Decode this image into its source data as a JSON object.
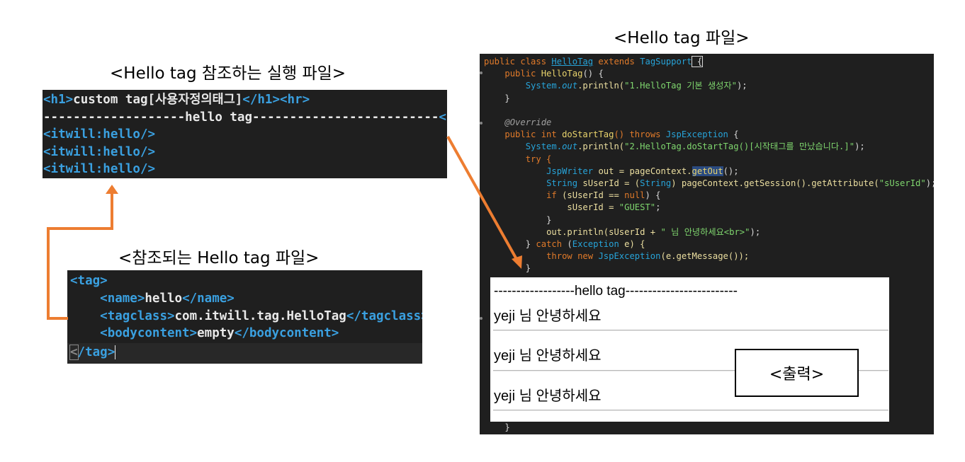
{
  "captions": {
    "exec_file": "<Hello tag 참조하는 실행 파일>",
    "referenced_file": "<참조되는 Hello tag 파일>",
    "java_file": "<Hello tag 파일>",
    "output_label": "<출력>"
  },
  "jsp": {
    "line1_open": "<h1>",
    "line1_text": "custom tag[사용자정의태그]",
    "line1_close": "</h1><hr>",
    "line2_text": "-------------------hello tag-------------------------",
    "line2_tag": "<br>",
    "line3": "<itwill:hello/>",
    "line4": "<itwill:hello/>",
    "line5": "<itwill:hello/>"
  },
  "tld": {
    "tag_open": "<tag>",
    "name_open": "<name>",
    "name_value": "hello",
    "name_close": "</name>",
    "tagclass_open": "<tagclass>",
    "tagclass_value": "com.itwill.tag.HelloTag",
    "tagclass_close": "</tagclass>",
    "bodycontent_open": "<bodycontent>",
    "bodycontent_value": "empty",
    "bodycontent_close": "</bodycontent>",
    "tag_close_lt": "<",
    "tag_close_rest": "/tag>"
  },
  "java": {
    "l1_a": "public class ",
    "l1_b": "HelloTag",
    "l1_c": " extends ",
    "l1_d": "TagSupport",
    "l1_e": " {",
    "l2_a": "public ",
    "l2_b": "HelloTag",
    "l2_c": "() {",
    "l3_a": "System.",
    "l3_b": "out",
    "l3_c": ".println(",
    "l3_d": "\"1.HelloTag 기본 생성자\"",
    "l3_e": ");",
    "l4": "}",
    "l5": "@Override",
    "l6_a": "public int ",
    "l6_b": "doStartTag",
    "l6_c": "() throws ",
    "l6_d": "JspException",
    "l6_e": " {",
    "l7_a": "System.",
    "l7_b": "out",
    "l7_c": ".println(",
    "l7_d": "\"2.HelloTag.doStartTag()[시작태그를 만났습니다.]\"",
    "l7_e": ");",
    "l8": "try {",
    "l9_a": "JspWriter",
    "l9_b": " out = pageContext.",
    "l9_c": "getOut",
    "l9_d": "();",
    "l10_a": "String",
    "l10_b": " sUserId = (",
    "l10_c": "String",
    "l10_d": ") pageContext.getSession().getAttribute(",
    "l10_e": "\"sUserId\"",
    "l10_f": ");",
    "l11_a": "if",
    "l11_b": " (sUserId == ",
    "l11_c": "null",
    "l11_d": ") {",
    "l12_a": "sUserId = ",
    "l12_b": "\"GUEST\"",
    "l12_c": ";",
    "l13": "}",
    "l14_a": "out.println(sUserId + ",
    "l14_b": "\" 님 안녕하세요<br>\"",
    "l14_c": ");",
    "l15_a": "} ",
    "l15_b": "catch",
    "l15_c": " (",
    "l15_d": "Exception",
    "l15_e": " e) {",
    "l16_a": "throw new ",
    "l16_b": "JspException",
    "l16_c": "(e.getMessage());",
    "l17": "}",
    "l18": "}"
  },
  "output": {
    "header": "------------------hello tag-------------------------",
    "line1": "yeji 님 안녕하세요",
    "line2": "yeji 님 안녕하세요",
    "line3": "yeji 님 안녕하세요"
  },
  "colors": {
    "arrow": "#ed7d31",
    "panel_bg": "#1f1f1f",
    "tag_blue": "#3aa0e0"
  }
}
